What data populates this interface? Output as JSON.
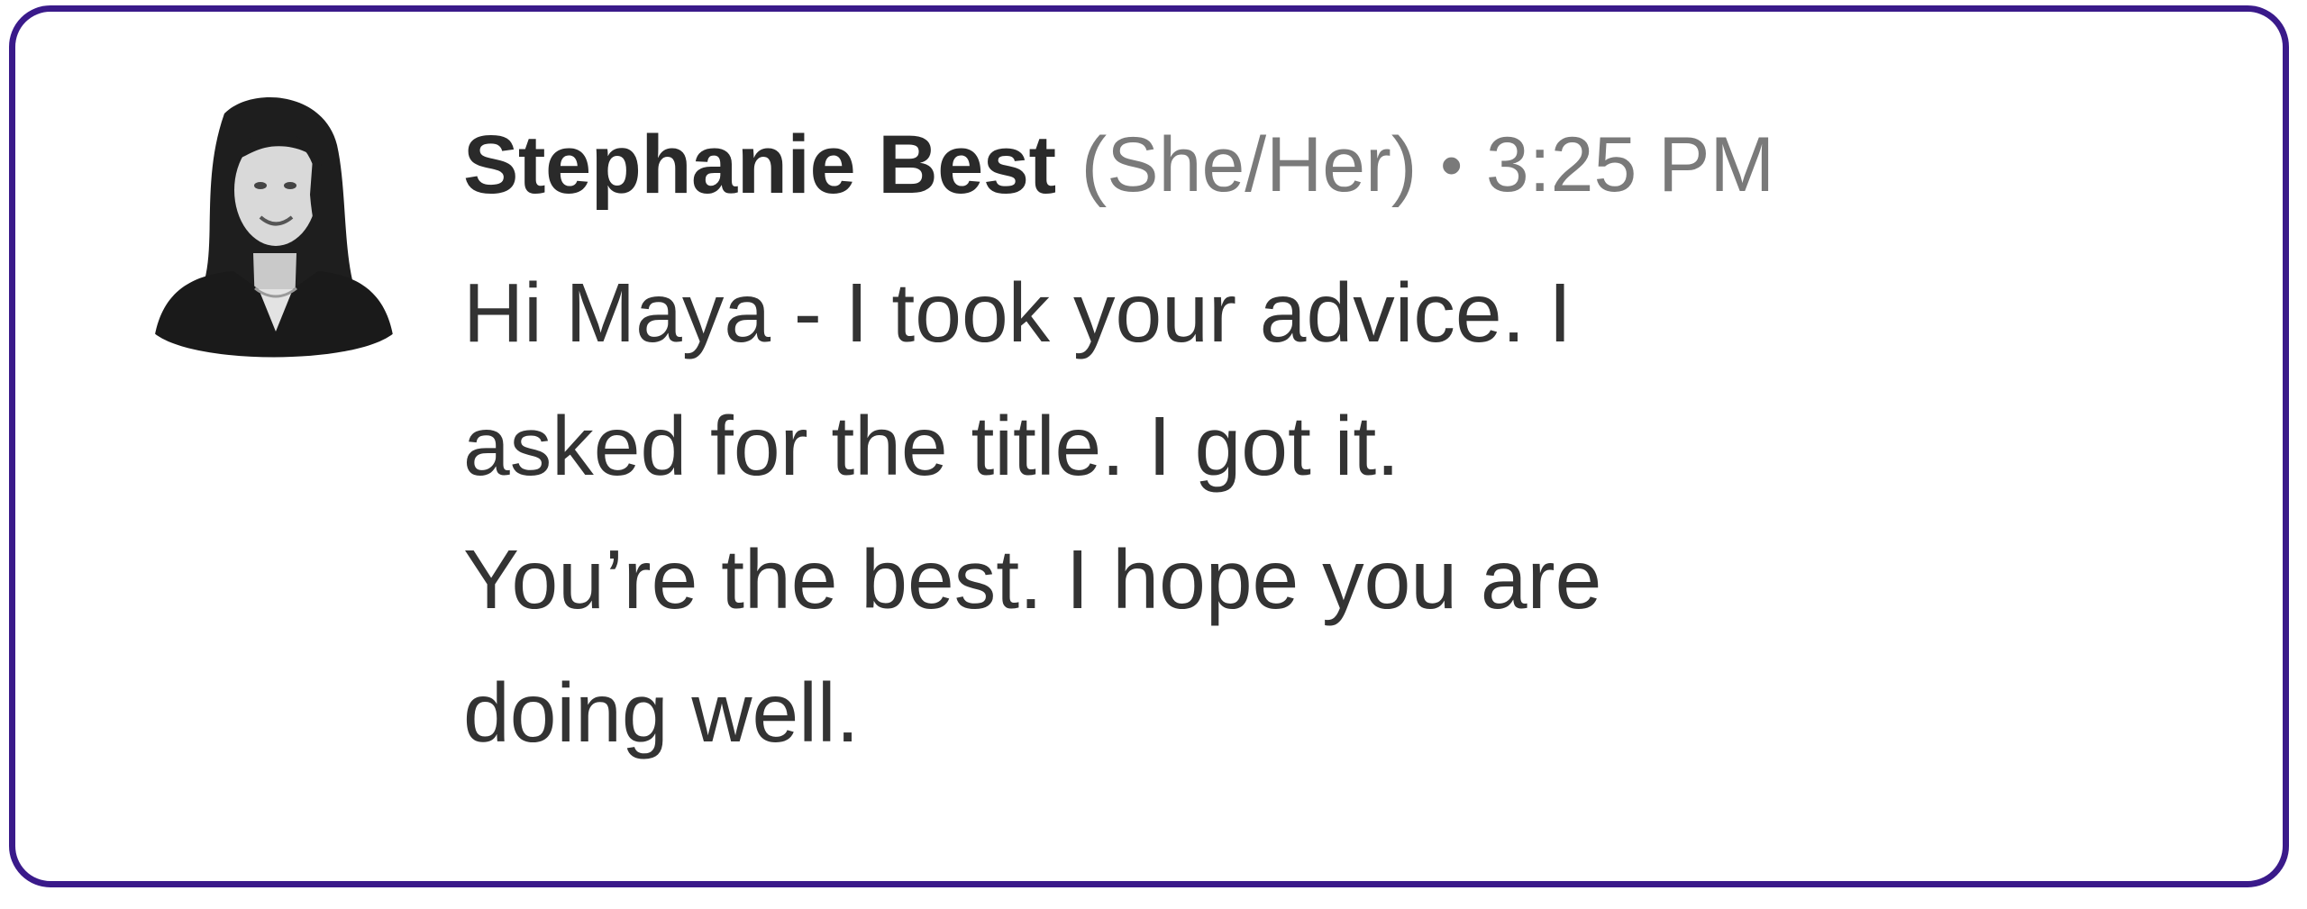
{
  "message": {
    "sender_name": "Stephanie Best",
    "pronouns": "(She/Her)",
    "separator": "•",
    "time": "3:25 PM",
    "text_lines": [
      "Hi Maya - I took your advice. I",
      "asked for the title. I got it.",
      "You’re the best. I hope you are",
      "doing well."
    ]
  },
  "colors": {
    "border": "#3a1a8a",
    "name_text": "#2a2a2a",
    "meta_text": "#7a7a7a",
    "body_text": "#333333",
    "background": "#ffffff"
  },
  "icons": {
    "avatar": "profile-photo-avatar"
  }
}
